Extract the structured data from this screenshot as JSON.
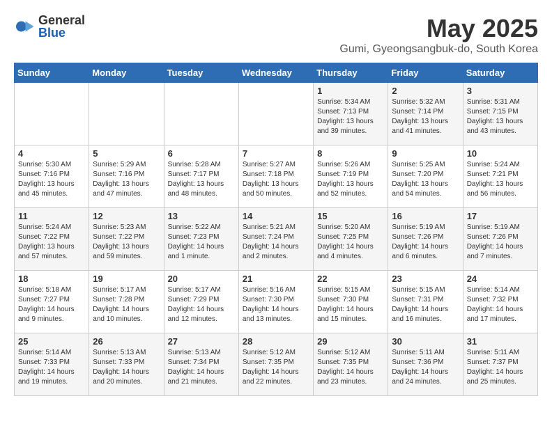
{
  "logo": {
    "general": "General",
    "blue": "Blue"
  },
  "title": "May 2025",
  "location": "Gumi, Gyeongsangbuk-do, South Korea",
  "days": [
    "Sunday",
    "Monday",
    "Tuesday",
    "Wednesday",
    "Thursday",
    "Friday",
    "Saturday"
  ],
  "weeks": [
    [
      {
        "day": "",
        "info": ""
      },
      {
        "day": "",
        "info": ""
      },
      {
        "day": "",
        "info": ""
      },
      {
        "day": "",
        "info": ""
      },
      {
        "day": "1",
        "info": "Sunrise: 5:34 AM\nSunset: 7:13 PM\nDaylight: 13 hours\nand 39 minutes."
      },
      {
        "day": "2",
        "info": "Sunrise: 5:32 AM\nSunset: 7:14 PM\nDaylight: 13 hours\nand 41 minutes."
      },
      {
        "day": "3",
        "info": "Sunrise: 5:31 AM\nSunset: 7:15 PM\nDaylight: 13 hours\nand 43 minutes."
      }
    ],
    [
      {
        "day": "4",
        "info": "Sunrise: 5:30 AM\nSunset: 7:16 PM\nDaylight: 13 hours\nand 45 minutes."
      },
      {
        "day": "5",
        "info": "Sunrise: 5:29 AM\nSunset: 7:16 PM\nDaylight: 13 hours\nand 47 minutes."
      },
      {
        "day": "6",
        "info": "Sunrise: 5:28 AM\nSunset: 7:17 PM\nDaylight: 13 hours\nand 48 minutes."
      },
      {
        "day": "7",
        "info": "Sunrise: 5:27 AM\nSunset: 7:18 PM\nDaylight: 13 hours\nand 50 minutes."
      },
      {
        "day": "8",
        "info": "Sunrise: 5:26 AM\nSunset: 7:19 PM\nDaylight: 13 hours\nand 52 minutes."
      },
      {
        "day": "9",
        "info": "Sunrise: 5:25 AM\nSunset: 7:20 PM\nDaylight: 13 hours\nand 54 minutes."
      },
      {
        "day": "10",
        "info": "Sunrise: 5:24 AM\nSunset: 7:21 PM\nDaylight: 13 hours\nand 56 minutes."
      }
    ],
    [
      {
        "day": "11",
        "info": "Sunrise: 5:24 AM\nSunset: 7:22 PM\nDaylight: 13 hours\nand 57 minutes."
      },
      {
        "day": "12",
        "info": "Sunrise: 5:23 AM\nSunset: 7:22 PM\nDaylight: 13 hours\nand 59 minutes."
      },
      {
        "day": "13",
        "info": "Sunrise: 5:22 AM\nSunset: 7:23 PM\nDaylight: 14 hours\nand 1 minute."
      },
      {
        "day": "14",
        "info": "Sunrise: 5:21 AM\nSunset: 7:24 PM\nDaylight: 14 hours\nand 2 minutes."
      },
      {
        "day": "15",
        "info": "Sunrise: 5:20 AM\nSunset: 7:25 PM\nDaylight: 14 hours\nand 4 minutes."
      },
      {
        "day": "16",
        "info": "Sunrise: 5:19 AM\nSunset: 7:26 PM\nDaylight: 14 hours\nand 6 minutes."
      },
      {
        "day": "17",
        "info": "Sunrise: 5:19 AM\nSunset: 7:26 PM\nDaylight: 14 hours\nand 7 minutes."
      }
    ],
    [
      {
        "day": "18",
        "info": "Sunrise: 5:18 AM\nSunset: 7:27 PM\nDaylight: 14 hours\nand 9 minutes."
      },
      {
        "day": "19",
        "info": "Sunrise: 5:17 AM\nSunset: 7:28 PM\nDaylight: 14 hours\nand 10 minutes."
      },
      {
        "day": "20",
        "info": "Sunrise: 5:17 AM\nSunset: 7:29 PM\nDaylight: 14 hours\nand 12 minutes."
      },
      {
        "day": "21",
        "info": "Sunrise: 5:16 AM\nSunset: 7:30 PM\nDaylight: 14 hours\nand 13 minutes."
      },
      {
        "day": "22",
        "info": "Sunrise: 5:15 AM\nSunset: 7:30 PM\nDaylight: 14 hours\nand 15 minutes."
      },
      {
        "day": "23",
        "info": "Sunrise: 5:15 AM\nSunset: 7:31 PM\nDaylight: 14 hours\nand 16 minutes."
      },
      {
        "day": "24",
        "info": "Sunrise: 5:14 AM\nSunset: 7:32 PM\nDaylight: 14 hours\nand 17 minutes."
      }
    ],
    [
      {
        "day": "25",
        "info": "Sunrise: 5:14 AM\nSunset: 7:33 PM\nDaylight: 14 hours\nand 19 minutes."
      },
      {
        "day": "26",
        "info": "Sunrise: 5:13 AM\nSunset: 7:33 PM\nDaylight: 14 hours\nand 20 minutes."
      },
      {
        "day": "27",
        "info": "Sunrise: 5:13 AM\nSunset: 7:34 PM\nDaylight: 14 hours\nand 21 minutes."
      },
      {
        "day": "28",
        "info": "Sunrise: 5:12 AM\nSunset: 7:35 PM\nDaylight: 14 hours\nand 22 minutes."
      },
      {
        "day": "29",
        "info": "Sunrise: 5:12 AM\nSunset: 7:35 PM\nDaylight: 14 hours\nand 23 minutes."
      },
      {
        "day": "30",
        "info": "Sunrise: 5:11 AM\nSunset: 7:36 PM\nDaylight: 14 hours\nand 24 minutes."
      },
      {
        "day": "31",
        "info": "Sunrise: 5:11 AM\nSunset: 7:37 PM\nDaylight: 14 hours\nand 25 minutes."
      }
    ]
  ]
}
